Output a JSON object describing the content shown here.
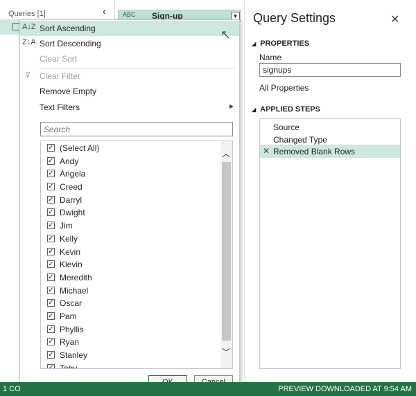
{
  "queries_pane": {
    "header": "Queries [1]",
    "collapse_icon": "chevron-left-icon"
  },
  "column": {
    "type_label": "ABC",
    "name": "Sign-up"
  },
  "status_bar": {
    "left": "1 CO",
    "right": "PREVIEW DOWNLOADED AT 9:54 AM",
    "color": "#217346"
  },
  "menu": {
    "sort_ascending": "Sort Ascending",
    "sort_descending": "Sort Descending",
    "clear_sort": "Clear Sort",
    "clear_filter": "Clear Filter",
    "remove_empty": "Remove Empty",
    "text_filters": "Text Filters"
  },
  "search": {
    "placeholder": "Search"
  },
  "filter_list": {
    "items": [
      {
        "label": "(Select All)",
        "checked": true
      },
      {
        "label": "Andy",
        "checked": true
      },
      {
        "label": "Angela",
        "checked": true
      },
      {
        "label": "Creed",
        "checked": true
      },
      {
        "label": "Darryl",
        "checked": true
      },
      {
        "label": "Dwight",
        "checked": true
      },
      {
        "label": "Jim",
        "checked": true
      },
      {
        "label": "Kelly",
        "checked": true
      },
      {
        "label": "Kevin",
        "checked": true
      },
      {
        "label": "Klevin",
        "checked": true
      },
      {
        "label": "Meredith",
        "checked": true
      },
      {
        "label": "Michael",
        "checked": true
      },
      {
        "label": "Oscar",
        "checked": true
      },
      {
        "label": "Pam",
        "checked": true
      },
      {
        "label": "Phyllis",
        "checked": true
      },
      {
        "label": "Ryan",
        "checked": true
      },
      {
        "label": "Stanley",
        "checked": true
      },
      {
        "label": "Toby",
        "checked": true
      }
    ]
  },
  "buttons": {
    "ok": "OK",
    "cancel": "Cancel"
  },
  "settings": {
    "title": "Query Settings",
    "properties_title": "PROPERTIES",
    "name_label": "Name",
    "name_value": "signups",
    "all_properties": "All Properties",
    "applied_steps_title": "APPLIED STEPS",
    "steps": [
      "Source",
      "Changed Type",
      "Removed Blank Rows"
    ],
    "selected_step": "Removed Blank Rows",
    "accent": "#cce8e0"
  }
}
